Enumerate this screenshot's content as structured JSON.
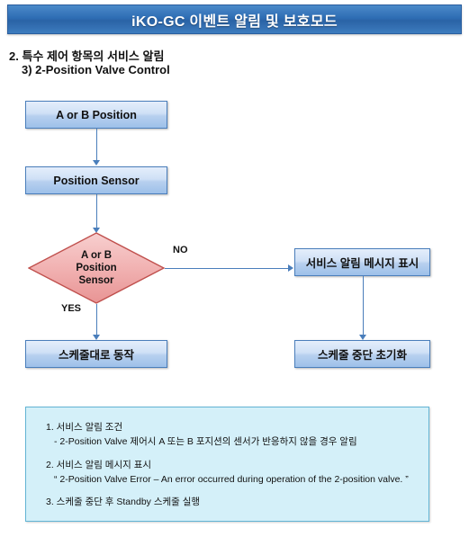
{
  "header": {
    "title": "iKO-GC 이벤트 알림 및 보호모드",
    "bar_color": "#2e6db4"
  },
  "headings": {
    "line1": "2. 특수 제어 항목의 서비스 알림",
    "line2": "3) 2-Position Valve Control"
  },
  "flowchart": {
    "box_fill": "#cfe0f6",
    "box_border": "#4a7ebb",
    "diamond_fill": "#f2b3b3",
    "diamond_border": "#c0504d",
    "connector_color": "#4a7ebb",
    "start_box": "A or B Position",
    "sensor_box": "Position Sensor",
    "decision": {
      "line1": "A or B",
      "line2": "Position",
      "line3": "Sensor"
    },
    "branch_no": "NO",
    "branch_yes": "YES",
    "alert_box": "서비스 알림 메시지 표시",
    "schedule_run_box": "스케줄대로 동작",
    "schedule_stop_box": "스케줄 중단 초기화"
  },
  "info_panel": {
    "bg_color": "#d4f0f9",
    "border_color": "#62b4d4",
    "item1_title": "1. 서비스 알림 조건",
    "item1_detail": "- 2-Position Valve 제어시 A 또는 B 포지션의 센서가 반응하지 않을 경우 알림",
    "item2_title": "2. 서비스 알림 메시지 표시",
    "item2_detail": "“ 2-Position Valve Error – An error occurred during operation of the 2-position valve. ”",
    "item3_title": "3. 스케줄 중단 후 Standby 스케줄 실행"
  }
}
